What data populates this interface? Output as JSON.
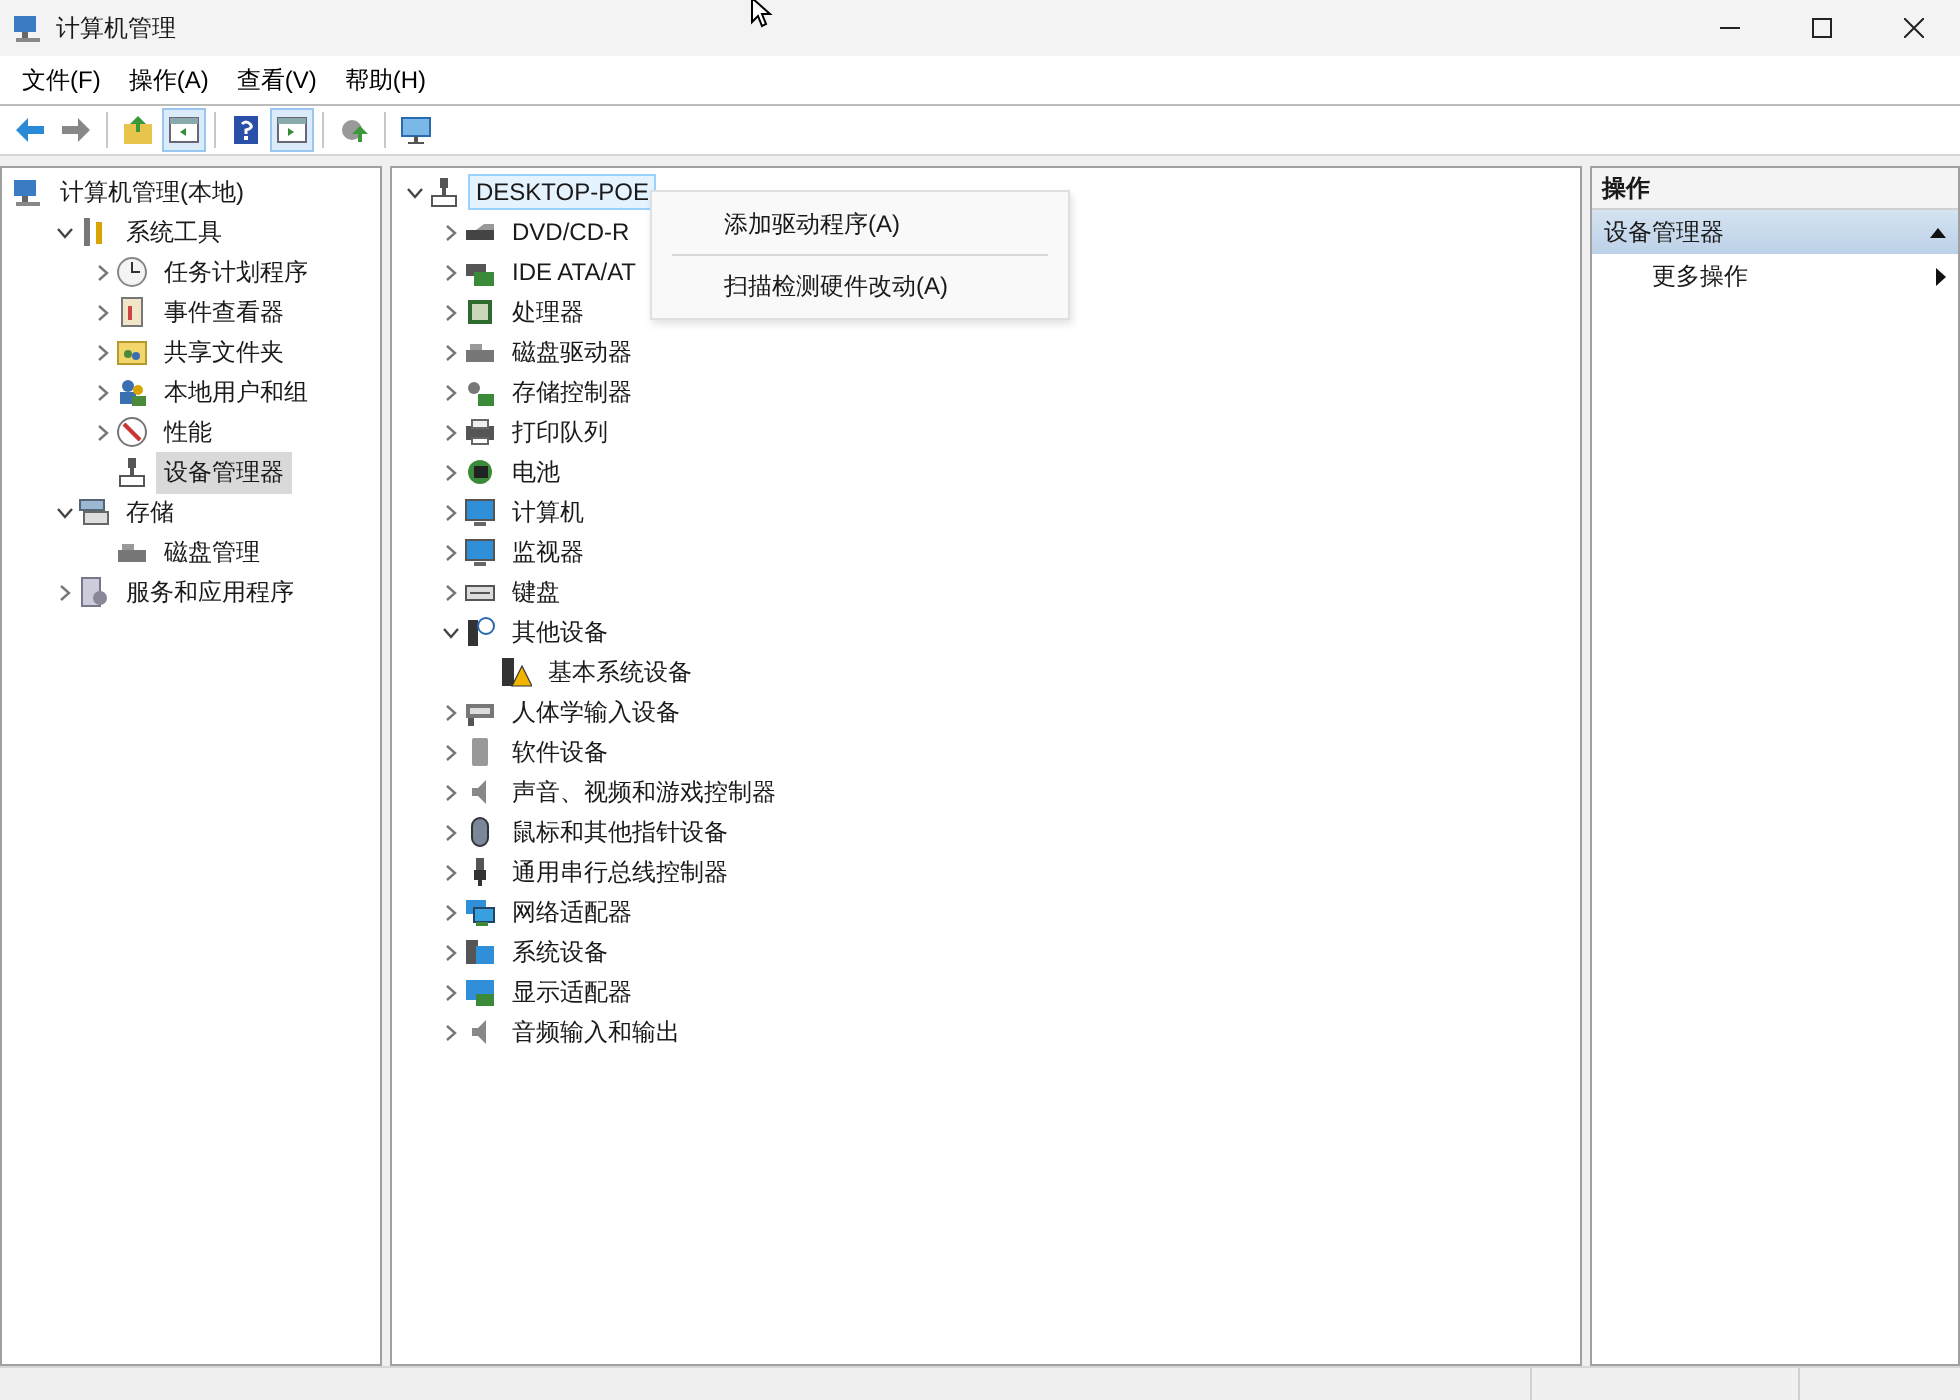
{
  "window": {
    "title": "计算机管理"
  },
  "menu": [
    "文件(F)",
    "操作(A)",
    "查看(V)",
    "帮助(H)"
  ],
  "toolbar": [
    {
      "pressed": false
    },
    {
      "pressed": false
    },
    {
      "pressed": false
    },
    {
      "pressed": true
    },
    {
      "pressed": false
    },
    {
      "pressed": true
    },
    {
      "pressed": false
    },
    {
      "pressed": false
    }
  ],
  "navigation_tree": [
    {
      "label": "计算机管理(本地)",
      "selected": false,
      "children": [
        {
          "label": "系统工具",
          "kind": "branch",
          "expanded": true,
          "selected": false,
          "children": [
            {
              "label": "任务计划程序",
              "kind": "branch",
              "expanded": false,
              "selected": false
            },
            {
              "label": "事件查看器",
              "kind": "branch",
              "expanded": false,
              "selected": false
            },
            {
              "label": "共享文件夹",
              "kind": "branch",
              "expanded": false,
              "selected": false
            },
            {
              "label": "本地用户和组",
              "kind": "branch",
              "expanded": false,
              "selected": false
            },
            {
              "label": "性能",
              "kind": "branch",
              "expanded": false,
              "selected": false
            },
            {
              "label": "设备管理器",
              "kind": "leaf",
              "selected": true
            }
          ]
        },
        {
          "label": "存储",
          "kind": "branch",
          "expanded": true,
          "selected": false,
          "children": [
            {
              "label": "磁盘管理",
              "kind": "leaf",
              "selected": false
            }
          ]
        },
        {
          "label": "服务和应用程序",
          "kind": "branch",
          "expanded": false,
          "selected": false
        }
      ]
    }
  ],
  "device_tree": [
    {
      "label": "DESKTOP-POE",
      "kind": "branch",
      "expanded": true,
      "selected": true,
      "children": [
        {
          "label": "DVD/CD-R",
          "kind": "branch",
          "expanded": false,
          "selected": false
        },
        {
          "label": "IDE ATA/AT",
          "kind": "branch",
          "expanded": false,
          "selected": false
        },
        {
          "label": "处理器",
          "kind": "branch",
          "expanded": false,
          "selected": false
        },
        {
          "label": "磁盘驱动器",
          "kind": "branch",
          "expanded": false,
          "selected": false
        },
        {
          "label": "存储控制器",
          "kind": "branch",
          "expanded": false,
          "selected": false
        },
        {
          "label": "打印队列",
          "kind": "branch",
          "expanded": false,
          "selected": false
        },
        {
          "label": "电池",
          "kind": "branch",
          "expanded": false,
          "selected": false
        },
        {
          "label": "计算机",
          "kind": "branch",
          "expanded": false,
          "selected": false
        },
        {
          "label": "监视器",
          "kind": "branch",
          "expanded": false,
          "selected": false
        },
        {
          "label": "键盘",
          "kind": "branch",
          "expanded": false,
          "selected": false
        },
        {
          "label": "其他设备",
          "kind": "branch",
          "expanded": true,
          "selected": false,
          "children": [
            {
              "label": "基本系统设备",
              "kind": "leaf",
              "selected": false
            }
          ]
        },
        {
          "label": "人体学输入设备",
          "kind": "branch",
          "expanded": false,
          "selected": false
        },
        {
          "label": "软件设备",
          "kind": "branch",
          "expanded": false,
          "selected": false
        },
        {
          "label": "声音、视频和游戏控制器",
          "kind": "branch",
          "expanded": false,
          "selected": false
        },
        {
          "label": "鼠标和其他指针设备",
          "kind": "branch",
          "expanded": false,
          "selected": false
        },
        {
          "label": "通用串行总线控制器",
          "kind": "branch",
          "expanded": false,
          "selected": false
        },
        {
          "label": "网络适配器",
          "kind": "branch",
          "expanded": false,
          "selected": false
        },
        {
          "label": "系统设备",
          "kind": "branch",
          "expanded": false,
          "selected": false
        },
        {
          "label": "显示适配器",
          "kind": "branch",
          "expanded": false,
          "selected": false
        },
        {
          "label": "音频输入和输出",
          "kind": "branch",
          "expanded": false,
          "selected": false
        }
      ]
    }
  ],
  "context_menu": [
    "添加驱动程序(A)",
    "扫描检测硬件改动(A)"
  ],
  "actions_pane": {
    "title": "操作",
    "section": {
      "label": "设备管理器",
      "expanded": true
    },
    "items": [
      "更多操作"
    ]
  }
}
